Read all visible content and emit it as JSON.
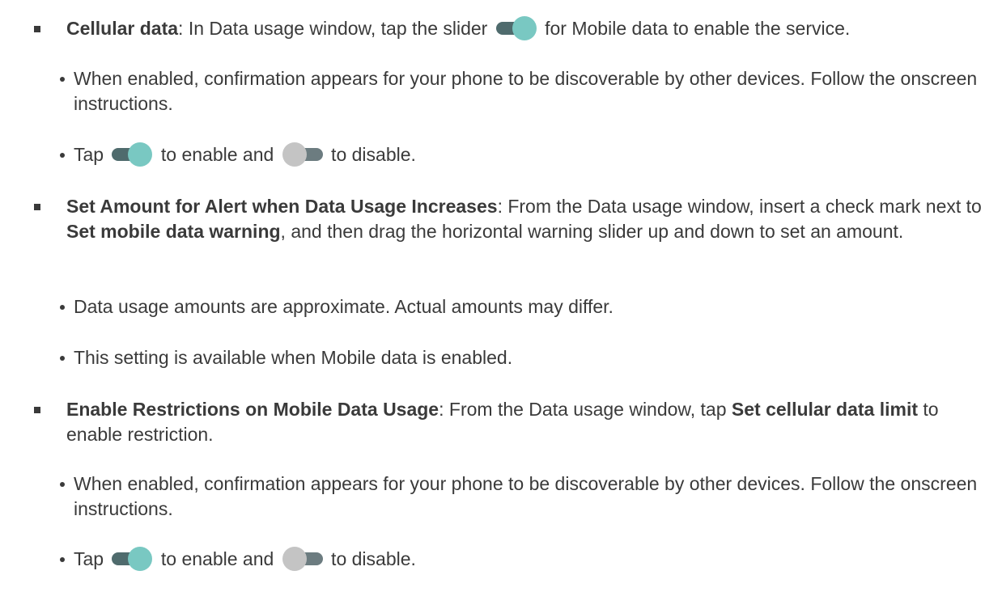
{
  "items": [
    {
      "label": "Cellular data",
      "text_a": ": In Data usage window, tap the slider ",
      "text_b": " for Mobile data to enable the service."
    },
    {
      "text": "When enabled, confirmation appears for your phone to be discoverable by other devices. Follow the onscreen instructions."
    },
    {
      "text_a": "Tap ",
      "text_b": " to enable and ",
      "text_c": " to disable."
    },
    {
      "label": "Set Amount for Alert when Data Usage Increases",
      "text_a": ": From the Data usage window, insert a check mark next to ",
      "bold_b": "Set mobile data warning",
      "text_c": ", and then drag the horizontal warning slider up and down to set an amount."
    },
    {
      "text": "Data usage amounts are approximate. Actual amounts may differ."
    },
    {
      "text": "This setting is available when Mobile data is enabled."
    },
    {
      "label": "Enable Restrictions on Mobile Data Usage",
      "text_a": ": From the Data usage window, tap ",
      "bold_b": "Set cellular data limit",
      "text_c": " to enable restriction."
    },
    {
      "text": "When enabled, confirmation appears for your phone to be discoverable by other devices. Follow the onscreen instructions."
    },
    {
      "text_a": "Tap ",
      "text_b": " to enable and ",
      "text_c": " to disable."
    }
  ],
  "icons": {
    "toggle_on": "toggle-on-icon",
    "toggle_off": "toggle-off-icon"
  },
  "colors": {
    "text": "#3a3a3a",
    "toggle_on_track": "#4f6b6d",
    "toggle_on_knob": "#79c8c2",
    "toggle_off_track": "#6c7c80",
    "toggle_off_knob": "#c4c4c4"
  }
}
